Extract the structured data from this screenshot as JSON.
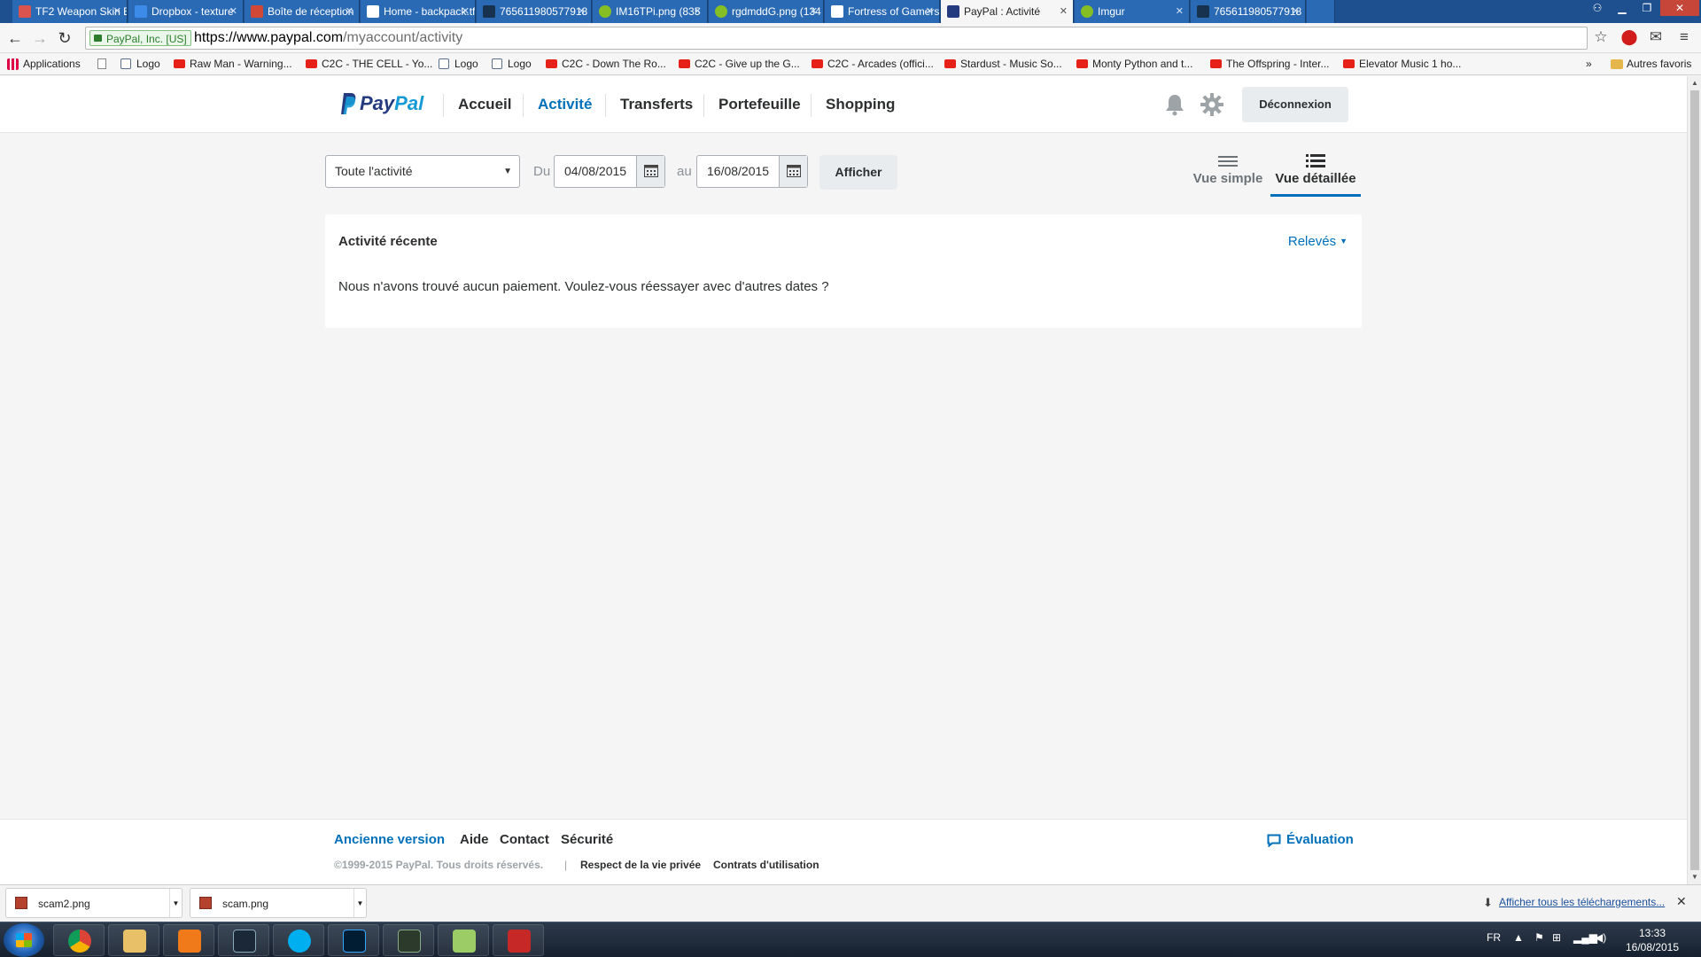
{
  "browser": {
    "tabs": [
      {
        "title": "TF2 Weapon Skin E",
        "color": "#d9534f"
      },
      {
        "title": "Dropbox - texture",
        "color": "#3d8be8"
      },
      {
        "title": "Boîte de réception",
        "color": "#d14836"
      },
      {
        "title": "Home - backpack.tf",
        "color": "#ffffff"
      },
      {
        "title": "765611980577918",
        "color": "#16324f"
      },
      {
        "title": "IM16TPi.png (835",
        "color": "#85bf25"
      },
      {
        "title": "rgdmddG.png (134",
        "color": "#85bf25"
      },
      {
        "title": "Fortress of Gamers",
        "color": "#ffffff"
      },
      {
        "title": "PayPal : Activité",
        "color": "#253b80"
      },
      {
        "title": "Imgur",
        "color": "#85bf25"
      },
      {
        "title": "765611980577918",
        "color": "#16324f"
      }
    ],
    "ev_label": "PayPal, Inc. [US]",
    "url_host": "https://www.paypal.com",
    "url_path": "/myaccount/activity",
    "bookmarks": [
      {
        "label": "Applications",
        "icon": "apps-icon"
      },
      {
        "label": "",
        "icon": "page-icon"
      },
      {
        "label": "Logo",
        "icon": "tf-icon"
      },
      {
        "label": "Raw Man - Warning...",
        "icon": "youtube-icon"
      },
      {
        "label": "C2C - THE CELL - Yo...",
        "icon": "youtube-icon"
      },
      {
        "label": "Logo",
        "icon": "tf-icon"
      },
      {
        "label": "Logo",
        "icon": "tf-icon"
      },
      {
        "label": "C2C - Down The Ro...",
        "icon": "youtube-icon"
      },
      {
        "label": "C2C - Give up the G...",
        "icon": "youtube-icon"
      },
      {
        "label": "C2C - Arcades (offici...",
        "icon": "youtube-icon"
      },
      {
        "label": "Stardust - Music So...",
        "icon": "youtube-icon"
      },
      {
        "label": "Monty Python and t...",
        "icon": "youtube-icon"
      },
      {
        "label": "The Offspring - Inter...",
        "icon": "youtube-icon"
      },
      {
        "label": "Elevator Music 1 ho...",
        "icon": "youtube-icon"
      }
    ],
    "bookmarks_overflow": "»",
    "other_bookmarks": "Autres favoris"
  },
  "header": {
    "logo_pay": "Pay",
    "logo_pal": "Pal",
    "nav": [
      {
        "label": "Accueil",
        "active": false
      },
      {
        "label": "Activité",
        "active": true
      },
      {
        "label": "Transferts",
        "active": false
      },
      {
        "label": "Portefeuille",
        "active": false
      },
      {
        "label": "Shopping",
        "active": false
      }
    ],
    "logout_label": "Déconnexion"
  },
  "filters": {
    "type_value": "Toute l'activité",
    "from_label": "Du",
    "from_date": "04/08/2015",
    "to_label": "au",
    "to_date": "16/08/2015",
    "show_label": "Afficher",
    "view_simple": "Vue simple",
    "view_detailed": "Vue détaillée"
  },
  "activity": {
    "title": "Activité récente",
    "statements_label": "Relevés",
    "empty_message": "Nous n'avons trouvé aucun paiement. Voulez-vous réessayer avec d'autres dates ?"
  },
  "footer": {
    "links": [
      "Ancienne version",
      "Aide",
      "Contact",
      "Sécurité"
    ],
    "copyright": "©1999-2015 PayPal. Tous droits réservés.",
    "separator": "|",
    "privacy": "Respect de la vie privée",
    "terms": "Contrats d'utilisation",
    "feedback": "Évaluation"
  },
  "downloads": {
    "items": [
      "scam2.png",
      "scam.png"
    ],
    "show_all": "Afficher tous les téléchargements..."
  },
  "taskbar": {
    "language": "FR",
    "time": "13:33",
    "date": "16/08/2015"
  },
  "colors": {
    "brand_dark": "#253b80",
    "brand_light": "#179bd7",
    "link_blue": "#0070ba"
  }
}
